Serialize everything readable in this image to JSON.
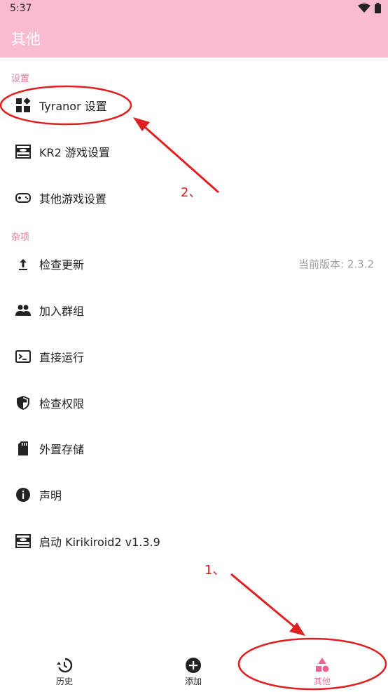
{
  "status": {
    "time": "5:37"
  },
  "appbar": {
    "title": "其他"
  },
  "sections": {
    "settings": "设置",
    "misc": "杂项"
  },
  "settings_items": [
    {
      "label": "Tyranor 设置",
      "icon": "dashboard-icon"
    },
    {
      "label": "KR2 游戏设置",
      "icon": "kr2-icon"
    },
    {
      "label": "其他游戏设置",
      "icon": "gamepad-icon"
    }
  ],
  "misc_items": [
    {
      "label": "检查更新",
      "icon": "upload-icon",
      "sub": "当前版本: 2.3.2"
    },
    {
      "label": "加入群组",
      "icon": "group-icon"
    },
    {
      "label": "直接运行",
      "icon": "terminal-icon"
    },
    {
      "label": "检查权限",
      "icon": "shield-icon"
    },
    {
      "label": "外置存储",
      "icon": "sd-card-icon"
    },
    {
      "label": "声明",
      "icon": "info-icon"
    },
    {
      "label": "启动 Kirikiroid2 v1.3.9",
      "icon": "kr2-icon"
    }
  ],
  "bottom_nav": [
    {
      "label": "历史",
      "icon": "history-icon"
    },
    {
      "label": "添加",
      "icon": "add-circle-icon"
    },
    {
      "label": "其他",
      "icon": "category-icon"
    }
  ],
  "annotations": {
    "step1": "1、",
    "step2": "2、"
  },
  "colors": {
    "accent": "#f8bbd0",
    "section": "#e07a9b",
    "annotation": "#e02020"
  }
}
